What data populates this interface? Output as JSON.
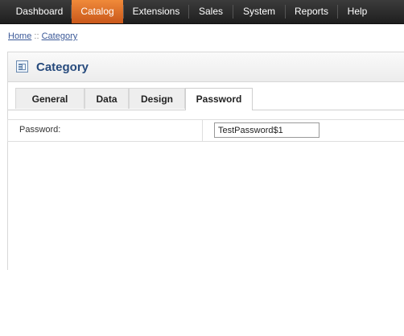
{
  "menu": {
    "items": [
      {
        "label": "Dashboard"
      },
      {
        "label": "Catalog"
      },
      {
        "label": "Extensions"
      },
      {
        "label": "Sales"
      },
      {
        "label": "System"
      },
      {
        "label": "Reports"
      },
      {
        "label": "Help"
      }
    ],
    "active": "Catalog"
  },
  "breadcrumb": {
    "home": "Home",
    "separator": "::",
    "current": "Category"
  },
  "panel": {
    "title": "Category",
    "icon": "category-icon"
  },
  "tabs": [
    {
      "label": "General"
    },
    {
      "label": "Data"
    },
    {
      "label": "Design"
    },
    {
      "label": "Password"
    }
  ],
  "active_tab": "Password",
  "form": {
    "password_label": "Password:",
    "password_value": "TestPassword$1"
  },
  "colors": {
    "menu_bg": "#2a2a2a",
    "menu_active": "#e0712b",
    "title": "#274b7d",
    "link": "#3b5998"
  }
}
